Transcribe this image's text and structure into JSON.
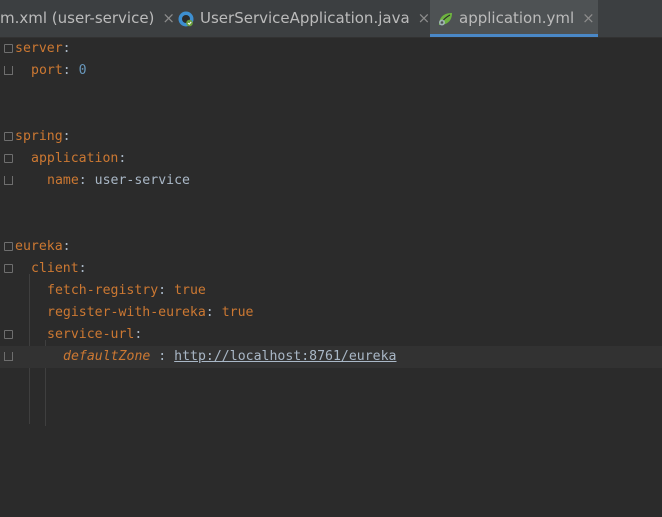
{
  "tabs": [
    {
      "label": "m.xml (user-service)",
      "icon": "maven-xml-icon",
      "active": false
    },
    {
      "label": "UserServiceApplication.java",
      "icon": "spring-java-class-icon",
      "active": false
    },
    {
      "label": "application.yml",
      "icon": "spring-leaf-icon",
      "active": true
    }
  ],
  "close_glyph": "×",
  "code": {
    "server_key": "server",
    "port_key": "port",
    "port_value": "0",
    "spring_key": "spring",
    "application_key": "application",
    "name_key": "name",
    "name_value": "user-service",
    "eureka_key": "eureka",
    "client_key": "client",
    "fetch_registry_key": "fetch-registry",
    "fetch_registry_value": "true",
    "register_key": "register-with-eureka",
    "register_value": "true",
    "service_url_key": "service-url",
    "default_zone_key": "defaultZone",
    "default_zone_value": "http://localhost:8761/eureka",
    "colon": ":",
    "spaced_colon": " : "
  },
  "colors": {
    "background": "#2b2b2b",
    "tab_bar": "#3c3f41",
    "key": "#cc7832",
    "text": "#a9b7c6",
    "number": "#6897bb",
    "accent": "#4a88c7"
  }
}
